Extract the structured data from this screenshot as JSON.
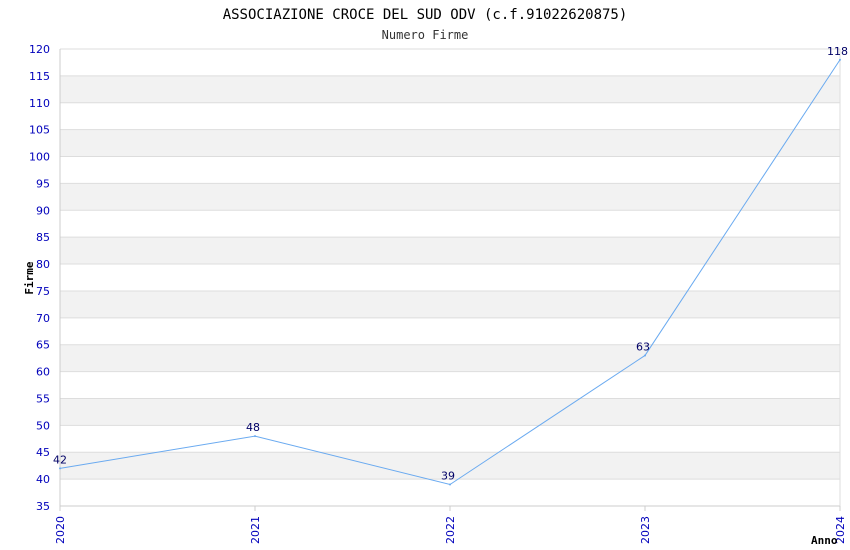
{
  "chart_data": {
    "type": "line",
    "title": "ASSOCIAZIONE CROCE DEL SUD ODV (c.f.91022620875)",
    "subtitle": "Numero Firme",
    "xlabel": "Anno",
    "ylabel": "Firme",
    "x": [
      "2020",
      "2021",
      "2022",
      "2023",
      "2024"
    ],
    "series": [
      {
        "values": [
          42,
          48,
          39,
          63,
          118
        ]
      }
    ],
    "ylim": [
      35,
      120
    ],
    "yticks": [
      35,
      40,
      45,
      50,
      55,
      60,
      65,
      70,
      75,
      80,
      85,
      90,
      95,
      100,
      105,
      110,
      115,
      120
    ],
    "grid": true,
    "legend": "none"
  },
  "colors": {
    "line": "#6aaaf0",
    "tick_labels": "#0000bb",
    "data_labels": "#000066",
    "band_shade": "#f2f2f2",
    "grid": "#dddddd",
    "axis": "#cccccc"
  }
}
